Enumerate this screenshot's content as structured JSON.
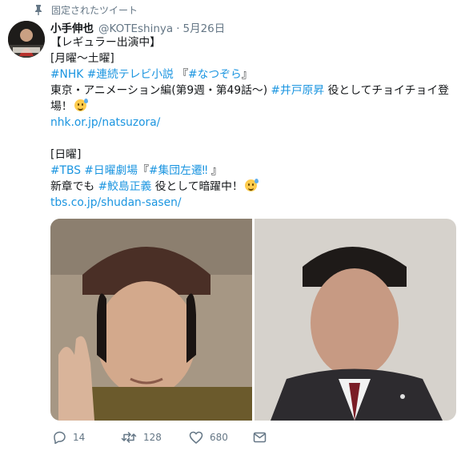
{
  "pinned_label": "固定されたツイート",
  "user": {
    "name": "小手伸也",
    "handle": "@KOTEshinya",
    "separator": "·",
    "date": "5月26日"
  },
  "tweet": {
    "l1": "【レギュラー出演中】",
    "l2": "[月曜〜土曜]",
    "l3a": "#NHK",
    "l3b": "#連続テレビ小説",
    "l3c": " 『",
    "l3d": "#なつぞら",
    "l3e": "』",
    "l4a": "東京・アニメーション編(第9週・第49話〜) ",
    "l4b": "#井戸原昇",
    "l4c": " 役としてチョイチョイ登場！",
    "l5": "nhk.or.jp/natsuzora/",
    "l6": "[日曜]",
    "l7a": "#TBS",
    "l7b": "#日曜劇場",
    "l7c": "『",
    "l7d": "#集団左遷‼",
    "l7e": " 』",
    "l8a": "新章でも ",
    "l8b": "#鮫島正義",
    "l8c": " 役として暗躍中！",
    "l9": "tbs.co.jp/shudan-sasen/"
  },
  "stats": {
    "replies": "14",
    "retweets": "128",
    "likes": "680"
  },
  "icons": [
    "pin-icon",
    "reply-icon",
    "retweet-icon",
    "like-icon",
    "dm-icon",
    "sweat-smile-emoji"
  ],
  "colors": {
    "link": "#1b95e0",
    "secondary": "#657786",
    "text": "#14171a"
  }
}
